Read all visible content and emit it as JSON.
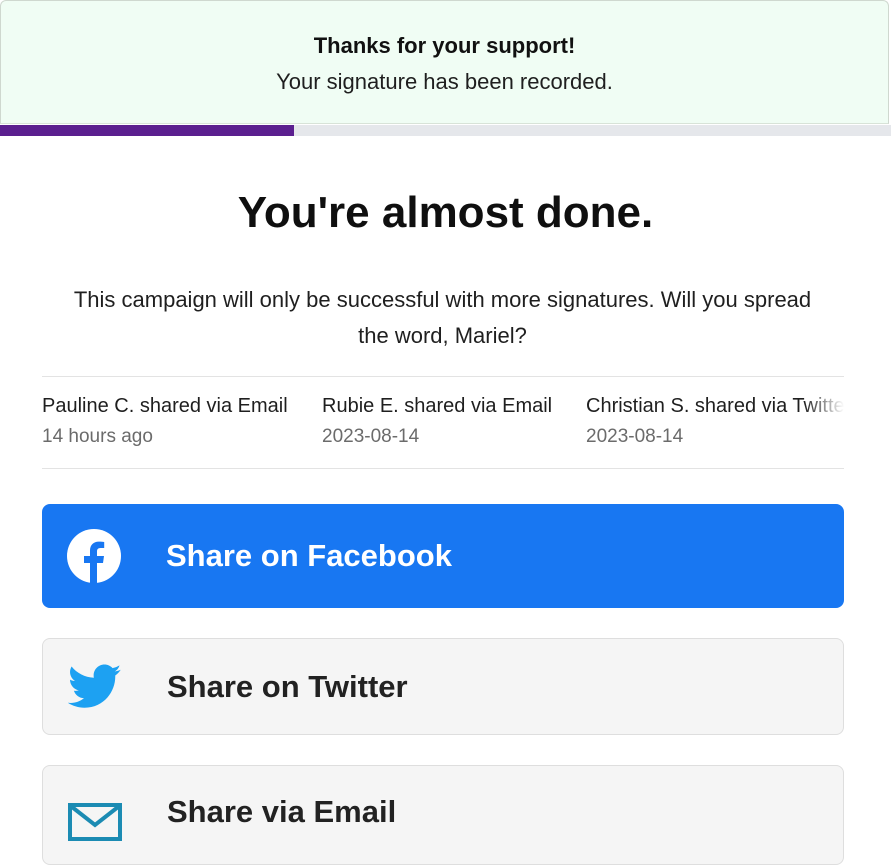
{
  "banner": {
    "title": "Thanks for your support!",
    "subtitle": "Your signature has been recorded."
  },
  "progress": {
    "fraction": 0.33,
    "color": "#5b1f8f"
  },
  "main": {
    "heading": "You're almost done.",
    "message": "This campaign will only be successful with more signatures. Will you spread the word, Mariel?"
  },
  "feed": [
    {
      "name": "Pauline C. shared via Email",
      "time": "14 hours ago"
    },
    {
      "name": "Rubie E. shared via Email",
      "time": "2023-08-14"
    },
    {
      "name": "Christian S. shared via Twitter",
      "time": "2023-08-14"
    }
  ],
  "share": {
    "facebook": {
      "label": "Share on Facebook",
      "icon": "facebook-icon",
      "color": "#1877f2"
    },
    "twitter": {
      "label": "Share on Twitter",
      "icon": "twitter-icon",
      "color": "#1da1f2"
    },
    "email": {
      "label": "Share via Email",
      "icon": "email-icon",
      "color": "#1b8bb3"
    }
  }
}
